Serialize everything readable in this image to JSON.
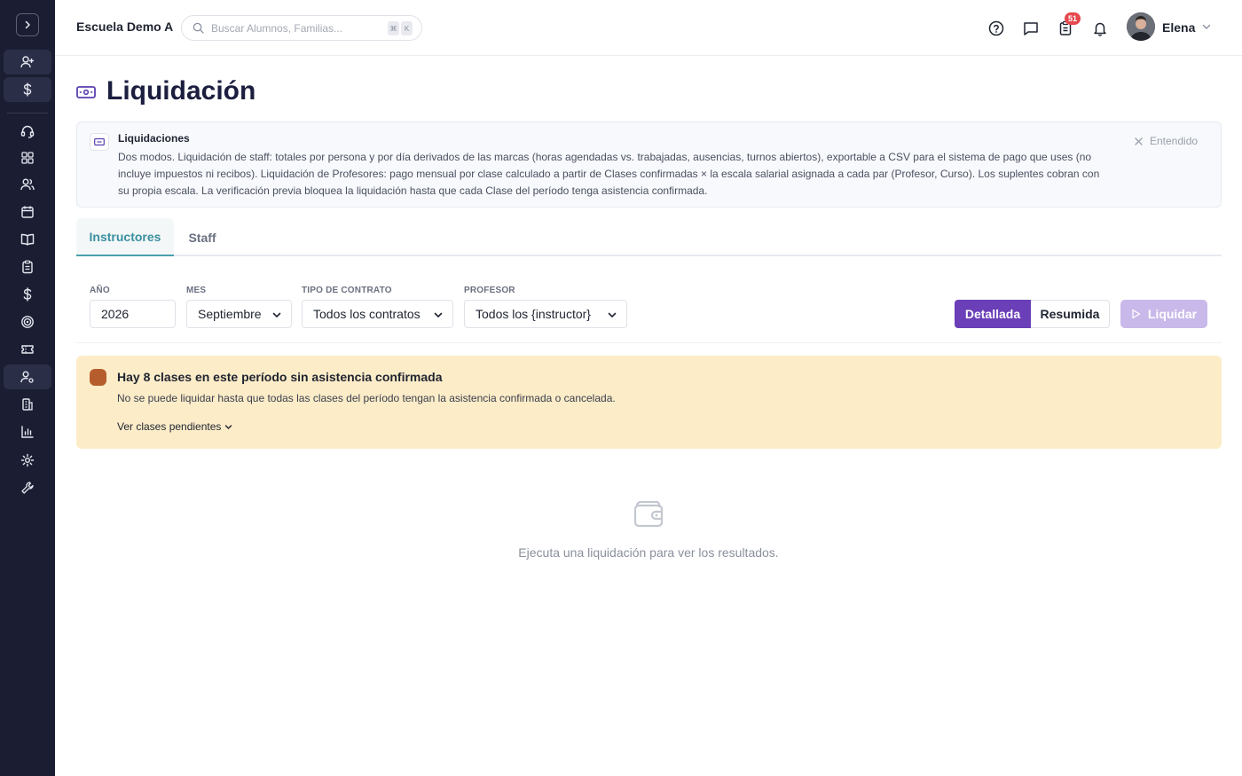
{
  "header": {
    "school_name": "Escuela Demo A",
    "search_placeholder": "Buscar Alumnos, Familias...",
    "search_kbd_1": "⌘",
    "search_kbd_2": "K",
    "tasks_badge": "51",
    "user_name": "Elena"
  },
  "page": {
    "title": "Liquidación"
  },
  "info": {
    "title": "Liquidaciones",
    "text": "Dos modos. Liquidación de staff: totales por persona y por día derivados de las marcas (horas agendadas vs. trabajadas, ausencias, turnos abiertos), exportable a CSV para el sistema de pago que uses (no incluye impuestos ni recibos). Liquidación de Profesores: pago mensual por clase calculado a partir de Clases confirmadas × la escala salarial asignada a cada par (Profesor, Curso). Los suplentes cobran con su propia escala. La verificación previa bloquea la liquidación hasta que cada Clase del período tenga asistencia confirmada.",
    "dismiss_label": "Entendido"
  },
  "tabs": [
    {
      "label": "Instructores",
      "active": true
    },
    {
      "label": "Staff",
      "active": false
    }
  ],
  "filters": {
    "year_label": "AÑO",
    "year_value": "2026",
    "month_label": "MES",
    "month_value": "Septiembre",
    "contract_label": "TIPO DE CONTRATO",
    "contract_value": "Todos los contratos",
    "teacher_label": "PROFESOR",
    "teacher_value": "Todos los {instructor}"
  },
  "view_toggle": {
    "detailed_label": "Detallada",
    "summary_label": "Resumida",
    "selected": "Detallada"
  },
  "run_button": {
    "label": "Liquidar",
    "disabled": true
  },
  "alert": {
    "title": "Hay 8 clases en este período sin asistencia confirmada",
    "text": "No se puede liquidar hasta que todas las clases del período tengan la asistencia confirmada o cancelada.",
    "link_label": "Ver clases pendientes"
  },
  "empty_state": {
    "text": "Ejecuta una liquidación para ver los resultados."
  },
  "colors": {
    "sidebar_bg": "#1b1e33",
    "accent_purple": "#6a3fb8",
    "tab_active": "#3a8fa0",
    "alert_bg": "#fcecc8",
    "alert_dot": "#b65d2e",
    "badge_red": "#e5484d"
  },
  "sidebar_icons": [
    "chevron-right-icon",
    "user-plus-icon",
    "dollar-icon",
    "headset-icon",
    "dashboard-icon",
    "users-icon",
    "calendar-icon",
    "book-icon",
    "clipboard-icon",
    "dollar-icon",
    "target-icon",
    "ticket-icon",
    "user-gear-icon",
    "building-icon",
    "bar-chart-icon",
    "gear-icon",
    "wrench-icon"
  ]
}
